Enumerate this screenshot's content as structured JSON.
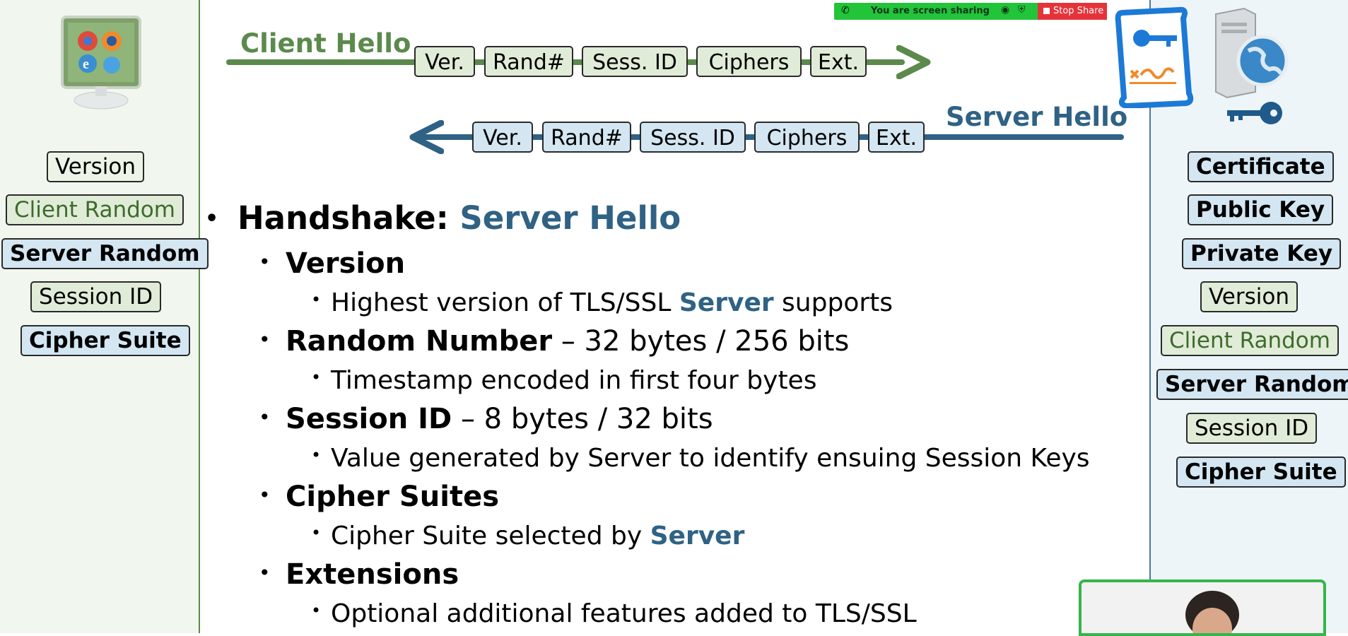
{
  "share_bar": {
    "status": "You are screen sharing",
    "stop_label": "Stop Share"
  },
  "client_hello": {
    "title": "Client Hello",
    "fields": [
      "Ver.",
      "Rand#",
      "Sess. ID",
      "Ciphers",
      "Ext."
    ]
  },
  "server_hello": {
    "title": "Server Hello",
    "fields": [
      "Ver.",
      "Rand#",
      "Sess. ID",
      "Ciphers",
      "Ext."
    ]
  },
  "left_panel": {
    "items": [
      "Version",
      "Client Random",
      "Server Random",
      "Session ID",
      "Cipher Suite"
    ]
  },
  "right_panel": {
    "items": [
      "Certificate",
      "Public Key",
      "Private Key",
      "Version",
      "Client Random",
      "Server Random",
      "Session ID",
      "Cipher Suite"
    ]
  },
  "slide": {
    "heading_prefix": "Handshake: ",
    "heading_highlight": "Server Hello",
    "version_title": "Version",
    "version_detail_pre": "Highest version of TLS/SSL ",
    "version_detail_highlight": "Server",
    "version_detail_post": " supports",
    "random_title": "Random Number",
    "random_detail": " – 32 bytes / 256 bits",
    "random_sub": "Timestamp encoded in first four bytes",
    "session_title": "Session ID",
    "session_detail": " – 8 bytes / 32 bits",
    "session_sub": "Value generated by Server to identify ensuing Session Keys",
    "cipher_title": "Cipher Suites",
    "cipher_sub_pre": "Cipher Suite selected by ",
    "cipher_sub_highlight": "Server",
    "ext_title": "Extensions",
    "ext_sub": "Optional additional features added to TLS/SSL"
  },
  "colors": {
    "client": "#5b8a4c",
    "server": "#2f6284",
    "share_green": "#22c43a",
    "stop_red": "#e5333a"
  }
}
